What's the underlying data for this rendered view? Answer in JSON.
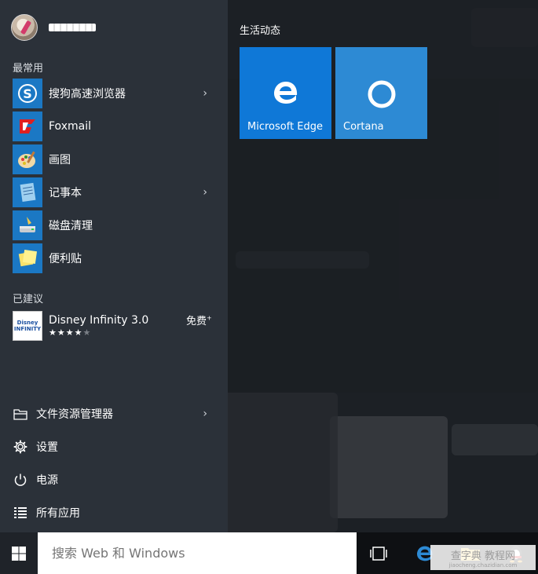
{
  "start_menu": {
    "sections": {
      "most_used": "最常用",
      "suggested": "已建议"
    },
    "apps": [
      {
        "label": "搜狗高速浏览器",
        "icon": "sogou-browser-icon",
        "has_submenu": true
      },
      {
        "label": "Foxmail",
        "icon": "foxmail-icon",
        "has_submenu": false
      },
      {
        "label": "画图",
        "icon": "paint-icon",
        "has_submenu": false
      },
      {
        "label": "记事本",
        "icon": "notepad-icon",
        "has_submenu": true
      },
      {
        "label": "磁盘清理",
        "icon": "disk-cleanup-icon",
        "has_submenu": false
      },
      {
        "label": "便利贴",
        "icon": "sticky-notes-icon",
        "has_submenu": false
      }
    ],
    "suggestion": {
      "title": "Disney Infinity 3.0",
      "icon_text": "Disney INFINITY",
      "rating_filled": 4,
      "rating_max": 5,
      "price": "免费",
      "price_mark": "+"
    },
    "bottom": [
      {
        "label": "文件资源管理器",
        "icon": "file-explorer-icon",
        "has_submenu": true
      },
      {
        "label": "设置",
        "icon": "gear-icon"
      },
      {
        "label": "电源",
        "icon": "power-icon"
      },
      {
        "label": "所有应用",
        "icon": "all-apps-icon"
      }
    ]
  },
  "tiles": {
    "group_title": "生活动态",
    "items": [
      {
        "label": "Microsoft Edge",
        "color": "#0f78d7",
        "icon": "edge-icon"
      },
      {
        "label": "Cortana",
        "color": "#2d8ad4",
        "icon": "cortana-icon"
      }
    ]
  },
  "taskbar": {
    "search_placeholder": "搜索 Web 和 Windows",
    "watermark": "查字典 教程网",
    "watermark_sub": "jiaocheng.chazidian.com"
  }
}
